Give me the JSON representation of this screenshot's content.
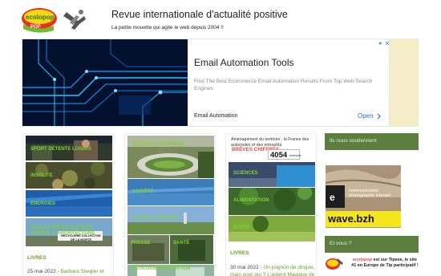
{
  "header": {
    "title": "Revue internationale d'actualité positive",
    "tagline": "La petite mouette qui agite le web depuis 2004 !!",
    "logo_text": "ecolopop"
  },
  "advertisement": {
    "title": "Email Automation Tools",
    "description": "Find The Best Ecommerce Email Automation Results From Top Web Search Engines",
    "brand": "Email Automation",
    "cta": "Open",
    "colors": {
      "accent": "#1a73e8",
      "background": "#f3ecc7"
    }
  },
  "column1": {
    "tiles": [
      {
        "label": "SPORT DÉTENTE LOISIRS"
      },
      {
        "label": "INSOLITE"
      },
      {
        "label": "ÉNERGIES"
      },
      {
        "label": "COLLECTIVITÉS LOCALES HABITAT & ARCHITECTURE"
      }
    ],
    "sign_text": "RECYCLERIE COLLECTIVE DE LA MORTE",
    "tag": "LIVRES",
    "date": "25 mai 2022",
    "link": "Barbara Stiegler et"
  },
  "column2": {
    "tiles": [
      {
        "label": "CULTURE CITOYENNE"
      },
      {
        "label": "SOCIÉTÉ"
      },
      {
        "label": "CLIMAT & ÉNERGIE"
      },
      {
        "label": "PRESSE"
      },
      {
        "label": "SANTÉ"
      },
      {
        "label": "ÉCOLOGIE PRÉVENTION"
      }
    ]
  },
  "column3": {
    "header": "Aménagement du territoire : la France des autoroutes et des entrepôts",
    "brev_label": "BRÈVES CHIFFRES",
    "counter_value": "4054",
    "counter_unit": "entrepôts",
    "tiles": [
      {
        "label": "SCIENCES"
      },
      {
        "label": "ALIMENTATION"
      },
      {
        "label": "SANTÉ"
      }
    ],
    "tag": "LIVRES",
    "date": "30 mai 2022",
    "link_text": "Un pognon de dingue, mais pour qui ? L'argent Magique de"
  },
  "sidebar": {
    "section1": "Ils nous soutiennent",
    "ad_text": "communication photographie internet",
    "ad_brand": "wave.bzh",
    "section2": "Et vous ?",
    "news_brand": "ecolopop",
    "news_text": "est sur Tipeee, le site #1 en Europe de Tip participatif !"
  }
}
